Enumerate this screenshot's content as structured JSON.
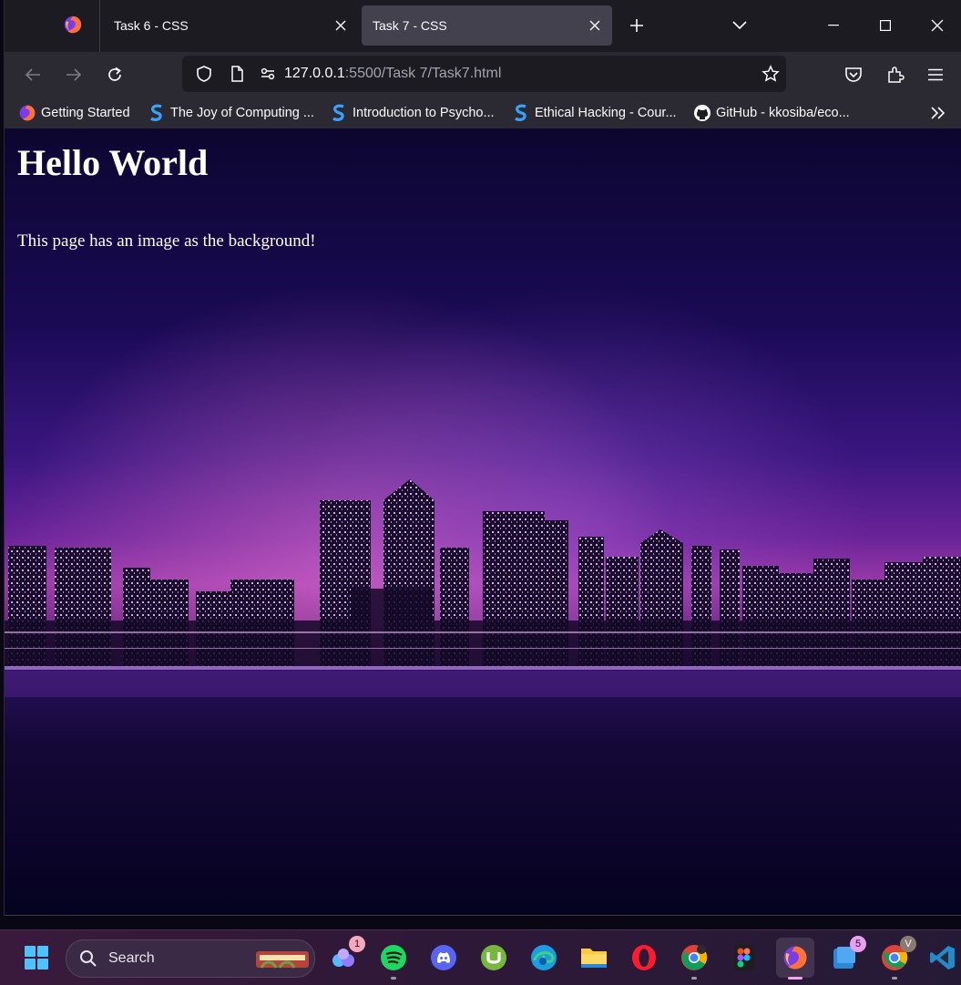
{
  "tabs": [
    {
      "label": "Task 6 - CSS",
      "active": false
    },
    {
      "label": "Task 7 - CSS",
      "active": true
    }
  ],
  "navbar": {
    "url_host": "127.0.0.1",
    "url_rest": ":5500/Task 7/Task7.html"
  },
  "bookmarks": [
    {
      "label": "Getting Started",
      "icon": "firefox-icon"
    },
    {
      "label": "The Joy of Computing ...",
      "icon": "swayam-icon"
    },
    {
      "label": "Introduction to Psycho...",
      "icon": "swayam-icon"
    },
    {
      "label": "Ethical Hacking - Cour...",
      "icon": "swayam-icon"
    },
    {
      "label": "GitHub - kkosiba/eco...",
      "icon": "github-icon"
    }
  ],
  "page": {
    "heading": "Hello World",
    "paragraph": "This page has an image as the background!"
  },
  "taskbar": {
    "search_label": "Search",
    "badges": {
      "copilot": "1",
      "todo": "5",
      "chrome_profile": "V"
    },
    "apps": [
      "windows-start-icon",
      "search-box",
      "copilot-icon",
      "spotify-icon",
      "discord-icon",
      "utorrent-icon",
      "edge-icon",
      "file-explorer-icon",
      "opera-icon",
      "chrome-icon",
      "figma-icon",
      "firefox-icon",
      "todo-icon",
      "chrome-profile-icon",
      "vscode-icon"
    ]
  },
  "colors": {
    "browser_chrome": "#1c1b22",
    "toolbar": "#2b2a33",
    "active_tab": "#42414d",
    "page_text": "#ffffff"
  }
}
